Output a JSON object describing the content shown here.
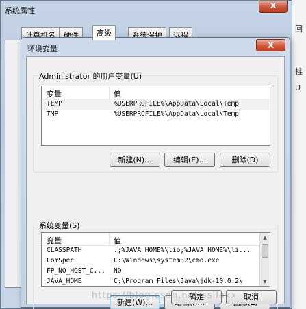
{
  "background_app": {
    "char_1": "回",
    "char_2": "挂",
    "char_3": "U"
  },
  "outer_window": {
    "title": "系统属性",
    "close_label": "X",
    "tabs": [
      {
        "label": "计算机名"
      },
      {
        "label": "硬件"
      },
      {
        "label": "高级"
      },
      {
        "label": "系统保护"
      },
      {
        "label": "远程"
      }
    ],
    "ok_label": "确定",
    "cancel_label": "取消"
  },
  "env_window": {
    "title": "环境变量",
    "close_label": "X",
    "user_group": {
      "title": "Administrator 的用户变量(U)",
      "col_var": "变量",
      "col_val": "值",
      "rows": [
        {
          "var": "TEMP",
          "val": "%USERPROFILE%\\AppData\\Local\\Temp"
        },
        {
          "var": "TMP",
          "val": "%USERPROFILE%\\AppData\\Local\\Temp"
        }
      ],
      "new_label": "新建(N)...",
      "edit_label": "编辑(E)...",
      "delete_label": "删除(D)"
    },
    "system_group": {
      "title": "系统变量(S)",
      "col_var": "变量",
      "col_val": "值",
      "rows": [
        {
          "var": "CLASSPATH",
          "val": ".;%JAVA_HOME%\\lib;%JAVA_HOME%\\li..."
        },
        {
          "var": "ComSpec",
          "val": "C:\\Windows\\system32\\cmd.exe"
        },
        {
          "var": "FP_NO_HOST_C...",
          "val": "NO"
        },
        {
          "var": "JAVA_HOME",
          "val": "C:\\Program Files\\Java\\jdk-10.0.2\\"
        }
      ],
      "new_label": "新建(W)...",
      "edit_label": "编辑(I)...",
      "delete_label": "删除(L)"
    }
  },
  "watermark": "https://blog.csdn.net/ssllaxx"
}
